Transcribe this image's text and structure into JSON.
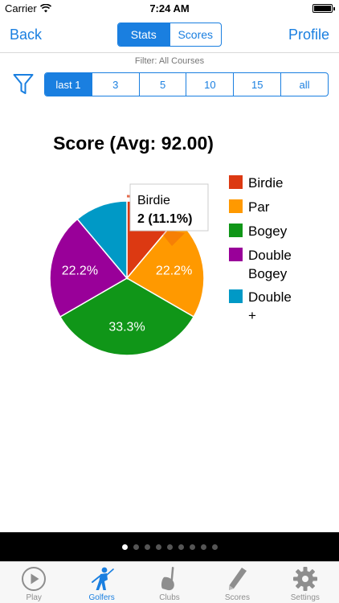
{
  "status_bar": {
    "carrier": "Carrier",
    "time": "7:24 AM"
  },
  "nav": {
    "back": "Back",
    "profile": "Profile",
    "segments": [
      {
        "label": "Stats",
        "active": true
      },
      {
        "label": "Scores",
        "active": false
      }
    ]
  },
  "filter": {
    "text": "Filter: All Courses",
    "ranges": [
      {
        "label": "last 1",
        "active": true
      },
      {
        "label": "3"
      },
      {
        "label": "5"
      },
      {
        "label": "10"
      },
      {
        "label": "15"
      },
      {
        "label": "all"
      }
    ]
  },
  "chart_data": {
    "type": "pie",
    "title": "Score (Avg: 92.00)",
    "slices": [
      {
        "name": "Birdie",
        "count": 2,
        "percent": 11.1,
        "color": "#dc3912"
      },
      {
        "name": "Par",
        "count": 4,
        "percent": 22.2,
        "color": "#ff9900"
      },
      {
        "name": "Bogey",
        "count": 6,
        "percent": 33.3,
        "color": "#109618"
      },
      {
        "name": "Double Bogey",
        "count": 4,
        "percent": 22.2,
        "color": "#990099"
      },
      {
        "name": "Double +",
        "count": 2,
        "percent": 11.1,
        "color": "#0099c6"
      }
    ],
    "legend": [
      [
        "Birdie"
      ],
      [
        "Par"
      ],
      [
        "Bogey"
      ],
      [
        "Double",
        "Bogey"
      ],
      [
        "Double",
        "+"
      ]
    ],
    "tooltip": {
      "name": "Birdie",
      "value": "2 (11.1%)"
    },
    "legend_position": "right"
  },
  "pager": {
    "count": 9,
    "active": 0
  },
  "tabs": [
    {
      "label": "Play",
      "icon": "play-icon",
      "active": false
    },
    {
      "label": "Golfers",
      "icon": "golfer-icon",
      "active": true
    },
    {
      "label": "Clubs",
      "icon": "club-icon",
      "active": false
    },
    {
      "label": "Scores",
      "icon": "pencil-icon",
      "active": false
    },
    {
      "label": "Settings",
      "icon": "gear-icon",
      "active": false
    }
  ],
  "colors": {
    "accent": "#1a7fe0"
  }
}
